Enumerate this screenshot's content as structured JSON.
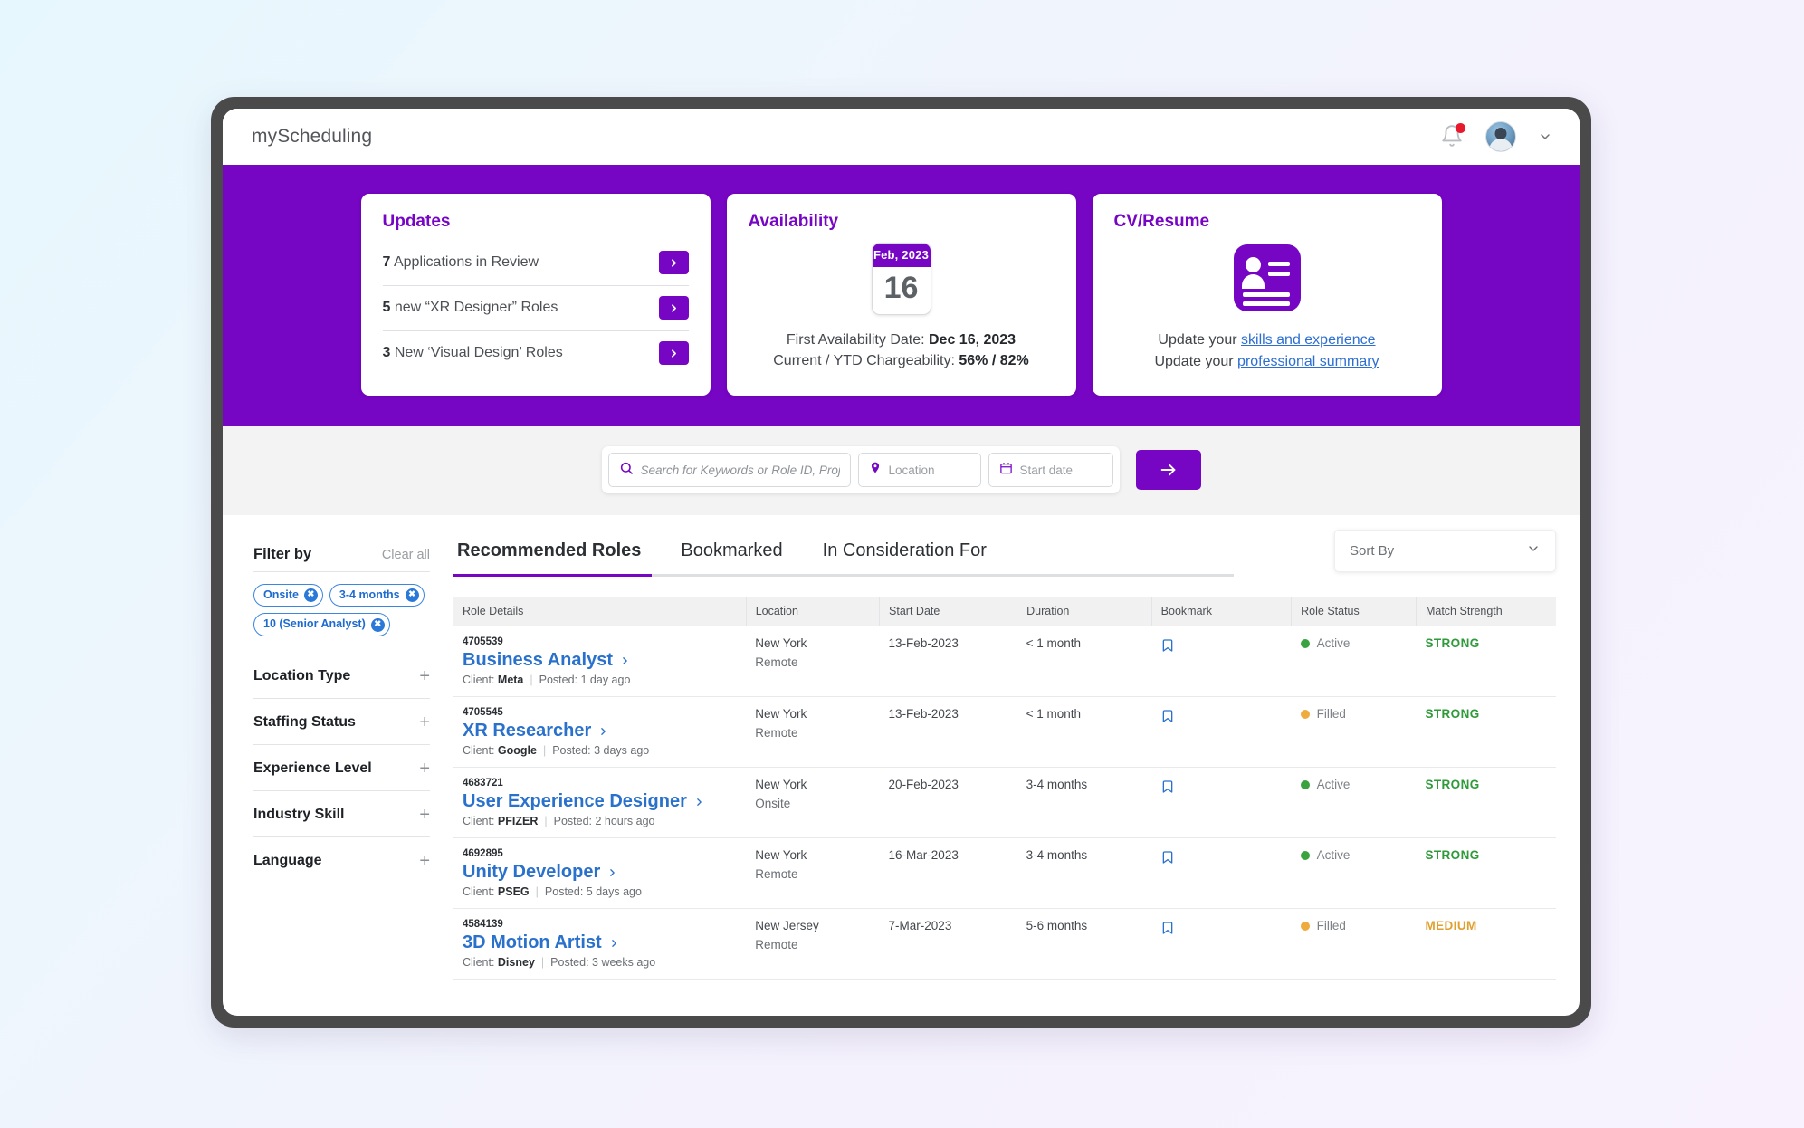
{
  "app": {
    "brand": "myScheduling"
  },
  "topbar": {
    "notifications_icon": "bell-icon",
    "avatar_icon": "user-avatar",
    "caret_icon": "chevron-down-icon"
  },
  "hero": {
    "updates": {
      "title": "Updates",
      "items": [
        {
          "count": "7",
          "text": " Applications in Review"
        },
        {
          "count": "5",
          "text": " new “XR Designer” Roles"
        },
        {
          "count": "3",
          "text": " New ‘Visual Design’ Roles"
        }
      ]
    },
    "availability": {
      "title": "Availability",
      "calendar_month": "Feb, 2023",
      "calendar_day": "16",
      "first_availability_label": "First Availability Date: ",
      "first_availability_value": "Dec 16, 2023",
      "chargeability_label": "Current / YTD Chargeability: ",
      "chargeability_value": "56% / 82%"
    },
    "cv": {
      "title": "CV/Resume",
      "icon": "id-card-icon",
      "line1_prefix": "Update your ",
      "line1_link": "skills and experience",
      "line2_prefix": "Update your ",
      "line2_link": "professional summary"
    }
  },
  "search": {
    "keywords_placeholder": "Search for Keywords or Role ID, Project/Client ..",
    "keywords_value": "",
    "location_placeholder": "Location",
    "location_value": "",
    "startdate_placeholder": "Start date",
    "startdate_value": "",
    "submit_icon": "arrow-right-icon",
    "search_icon": "search-icon",
    "pin_icon": "map-pin-icon",
    "calendar_icon": "calendar-icon"
  },
  "filters": {
    "title": "Filter by",
    "clear_all": "Clear all",
    "chips": [
      {
        "label": "Onsite"
      },
      {
        "label": "3-4 months"
      },
      {
        "label": "10 (Senior Analyst)"
      }
    ],
    "facets": [
      {
        "label": "Location Type",
        "expand": "+"
      },
      {
        "label": "Staffing Status",
        "expand": "+"
      },
      {
        "label": "Experience Level",
        "expand": "+"
      },
      {
        "label": "Industry Skill",
        "expand": "+"
      },
      {
        "label": "Language",
        "expand": "+"
      }
    ]
  },
  "tabs": [
    {
      "label": "Recommended Roles",
      "active": true
    },
    {
      "label": "Bookmarked",
      "active": false
    },
    {
      "label": "In Consideration For",
      "active": false
    }
  ],
  "sort": {
    "label": "Sort By",
    "caret_icon": "chevron-down-icon"
  },
  "table": {
    "headers": [
      "Role Details",
      "Location",
      "Start Date",
      "Duration",
      "Bookmark",
      "Role Status",
      "Match Strength"
    ],
    "rows": [
      {
        "id": "4705539",
        "title": "Business Analyst",
        "client_label": "Client: ",
        "client": "Meta",
        "posted": "Posted: 1 day ago",
        "location_main": "New York",
        "location_sub": "Remote",
        "start_date": "13-Feb-2023",
        "duration": "< 1 month",
        "status": "Active",
        "status_type": "active",
        "match": "STRONG",
        "match_type": "strong"
      },
      {
        "id": "4705545",
        "title": "XR Researcher",
        "client_label": "Client: ",
        "client": "Google",
        "posted": "Posted: 3 days ago",
        "location_main": "New York",
        "location_sub": "Remote",
        "start_date": "13-Feb-2023",
        "duration": "< 1 month",
        "status": "Filled",
        "status_type": "filled",
        "match": "STRONG",
        "match_type": "strong"
      },
      {
        "id": "4683721",
        "title": "User Experience Designer",
        "client_label": "Client: ",
        "client": "PFIZER",
        "posted": "Posted: 2 hours ago",
        "location_main": "New York",
        "location_sub": "Onsite",
        "start_date": "20-Feb-2023",
        "duration": "3-4 months",
        "status": "Active",
        "status_type": "active",
        "match": "STRONG",
        "match_type": "strong"
      },
      {
        "id": "4692895",
        "title": "Unity Developer",
        "client_label": "Client: ",
        "client": "PSEG",
        "posted": "Posted: 5 days ago",
        "location_main": "New York",
        "location_sub": "Remote",
        "start_date": "16-Mar-2023",
        "duration": "3-4 months",
        "status": "Active",
        "status_type": "active",
        "match": "STRONG",
        "match_type": "strong"
      },
      {
        "id": "4584139",
        "title": "3D Motion Artist",
        "client_label": "Client: ",
        "client": "Disney",
        "posted": "Posted: 3 weeks ago",
        "location_main": "New Jersey",
        "location_sub": "Remote",
        "start_date": "7-Mar-2023",
        "duration": "5-6 months",
        "status": "Filled",
        "status_type": "filled",
        "match": "MEDIUM",
        "match_type": "medium"
      }
    ]
  },
  "colors": {
    "brand_purple": "#7605c4",
    "link_blue": "#2a71cc",
    "status_active": "#3aa340",
    "status_filled": "#eeab3e",
    "match_strong": "#2f9a3a",
    "match_medium": "#e0a02e",
    "chip_blue": "#2a79d8"
  }
}
